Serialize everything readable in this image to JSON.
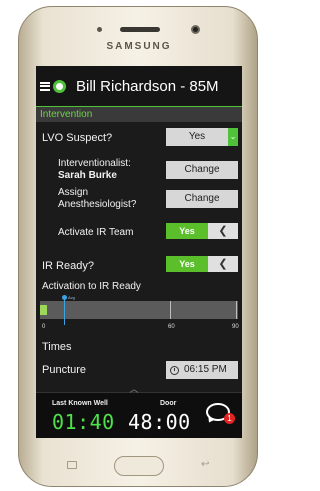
{
  "device": {
    "brand": "SAMSUNG"
  },
  "header": {
    "patient": "Bill Richardson - 85M"
  },
  "section": {
    "title": "Intervention"
  },
  "lvo": {
    "label": "LVO Suspect?",
    "value": "Yes",
    "dropdown_glyph": "⌄"
  },
  "interventionalist": {
    "label": "Interventionalist:",
    "name": "Sarah Burke",
    "button": "Change"
  },
  "anesthesiologist": {
    "label_line1": "Assign",
    "label_line2": "Anesthesiologist?",
    "button": "Change"
  },
  "ir_team": {
    "label": "Activate IR Team",
    "toggle": "Yes",
    "arrow": "❮"
  },
  "ir_ready": {
    "label": "IR Ready?",
    "toggle": "Yes",
    "arrow": "❮"
  },
  "timeline": {
    "label": "Activation to IR Ready",
    "tick_labels": [
      "0",
      "60",
      "90"
    ],
    "marker_tag": "Avg",
    "progress_value": 3
  },
  "times": {
    "label": "Times"
  },
  "puncture": {
    "label": "Puncture",
    "time": "06:15 PM"
  },
  "footer": {
    "last_known_well_label": "Last Known Well",
    "last_known_well_time": "01:40",
    "door_label": "Door",
    "door_time": "48:00",
    "chat_badge": "1",
    "caret": "︿"
  },
  "nav": {
    "back_glyph": "↩"
  },
  "colors": {
    "accent_green": "#4fc23a",
    "toggle_green": "#5bbf2b",
    "badge_red": "#e02323",
    "marker_blue": "#3aa3e6"
  }
}
